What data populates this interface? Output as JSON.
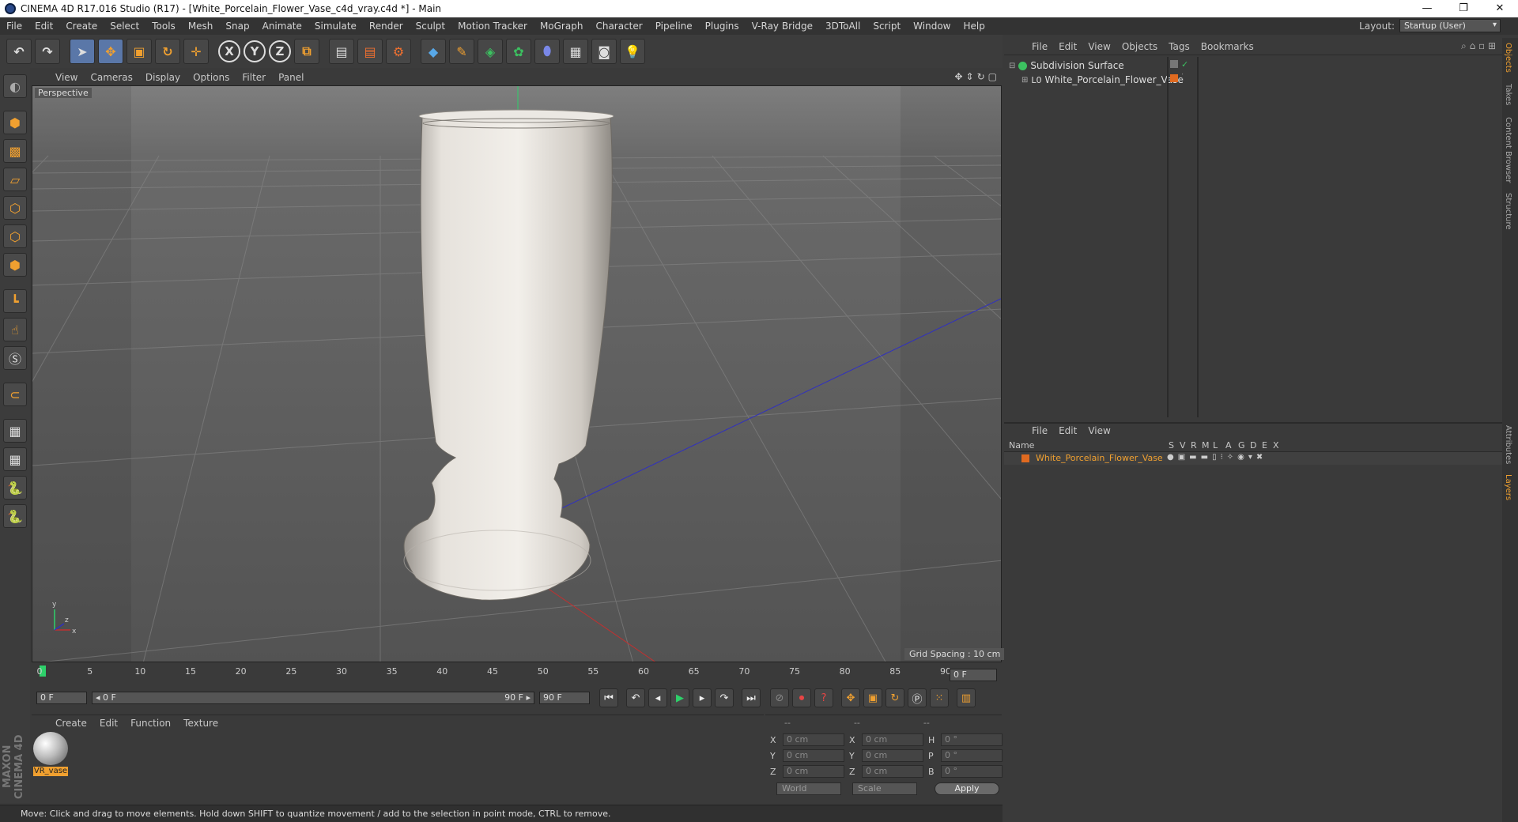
{
  "window": {
    "title": "CINEMA 4D R17.016 Studio (R17) - [White_Porcelain_Flower_Vase_c4d_vray.c4d *] - Main",
    "controls": [
      "—",
      "❐",
      "✕"
    ]
  },
  "menu": [
    "File",
    "Edit",
    "Create",
    "Select",
    "Tools",
    "Mesh",
    "Snap",
    "Animate",
    "Simulate",
    "Render",
    "Sculpt",
    "Motion Tracker",
    "MoGraph",
    "Character",
    "Pipeline",
    "Plugins",
    "V-Ray Bridge",
    "3DToAll",
    "Script",
    "Window",
    "Help"
  ],
  "layout": {
    "label": "Layout:",
    "value": "Startup (User)"
  },
  "toolbar": {
    "undo": "↶",
    "redo": "↷",
    "axis_x": "X",
    "axis_y": "Y",
    "axis_z": "Z"
  },
  "viewport": {
    "menu": [
      "View",
      "Cameras",
      "Display",
      "Options",
      "Filter",
      "Panel"
    ],
    "label": "Perspective",
    "grid_spacing": "Grid Spacing : 10 cm",
    "axes": {
      "y": "y",
      "x": "x",
      "z": "z"
    }
  },
  "timeline": {
    "ticks": [
      "0",
      "5",
      "10",
      "15",
      "20",
      "25",
      "30",
      "35",
      "40",
      "45",
      "50",
      "55",
      "60",
      "65",
      "70",
      "75",
      "80",
      "85",
      "90"
    ],
    "current_frame": "0 F",
    "start": "0 F",
    "range_start": "◂ 0 F",
    "range_end": "90 F ▸",
    "end": "90 F"
  },
  "material_manager": {
    "menu": [
      "Create",
      "Edit",
      "Function",
      "Texture"
    ],
    "materials": [
      {
        "name": "VR_vase"
      }
    ]
  },
  "coordinates": {
    "headers": [
      "--",
      "--",
      "--"
    ],
    "rows": [
      {
        "a": "X",
        "av": "0 cm",
        "b": "X",
        "bv": "0 cm",
        "c": "H",
        "cv": "0 °"
      },
      {
        "a": "Y",
        "av": "0 cm",
        "b": "Y",
        "bv": "0 cm",
        "c": "P",
        "cv": "0 °"
      },
      {
        "a": "Z",
        "av": "0 cm",
        "b": "Z",
        "bv": "0 cm",
        "c": "B",
        "cv": "0 °"
      }
    ],
    "world": "World",
    "scale": "Scale",
    "apply": "Apply"
  },
  "status": "Move: Click and drag to move elements. Hold down SHIFT to quantize movement / add to the selection in point mode, CTRL to remove.",
  "object_manager": {
    "menu": [
      "File",
      "Edit",
      "View",
      "Objects",
      "Tags",
      "Bookmarks"
    ],
    "objects": [
      {
        "name": "Subdivision Surface"
      },
      {
        "name": "White_Porcelain_Flower_Vase"
      }
    ]
  },
  "layer_manager": {
    "menu": [
      "File",
      "Edit",
      "View"
    ],
    "columns": [
      "Name",
      "S",
      "V",
      "R",
      "M",
      "L",
      "A",
      "G",
      "D",
      "E",
      "X"
    ],
    "layers": [
      {
        "name": "White_Porcelain_Flower_Vase",
        "color": "#e06a20"
      }
    ]
  },
  "right_tabs": [
    "Objects",
    "Takes",
    "Content Browser",
    "Structure",
    "Attributes",
    "Layers"
  ],
  "logo": "MAXON CINEMA 4D"
}
